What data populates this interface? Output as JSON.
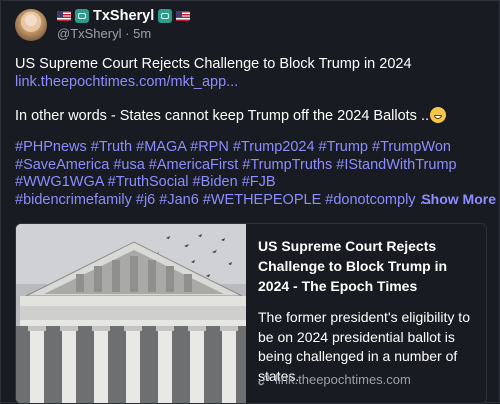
{
  "post": {
    "display_name": "TxSheryl",
    "handle": "@TxSheryl",
    "separator": "·",
    "timestamp": "5m",
    "title": "US Supreme Court Rejects Challenge to Block Trump in 2024",
    "link_text": "link.theepochtimes.com/mkt_app...",
    "body_text": "In other words - States cannot keep Trump off the 2024 Ballots ..",
    "hashtag_lines": [
      "#PHPnews #Truth #MAGA #RPN #Trump2024 #Trump #TrumpWon",
      "#SaveAmerica #usa #AmericaFirst #TrumpTruths #IStandWithTrump",
      "#WWG1WGA #TruthSocial #Biden #FJB",
      "#bidencrimefamily #j6 #Jan6 #WETHEPEOPLE #donotcomply ..."
    ],
    "show_more_label": "Show More"
  },
  "card": {
    "title": "US Supreme Court Rejects Challenge to Block Trump in 2024 - The Epoch Times",
    "description": "The former president's eligibility to be on 2024 presidential ballot is being challenged in a number of states.",
    "domain": "link.theepochtimes.com"
  },
  "icons": {
    "name_badges": [
      "us-flag-icon",
      "robot-icon",
      "robot-icon",
      "us-flag-icon"
    ],
    "emoji": "grinning-face-icon",
    "link": "link-icon"
  },
  "colors": {
    "background": "#191b22",
    "link": "#8c8dff",
    "muted": "#9aa0ab",
    "text": "#ffffff"
  }
}
